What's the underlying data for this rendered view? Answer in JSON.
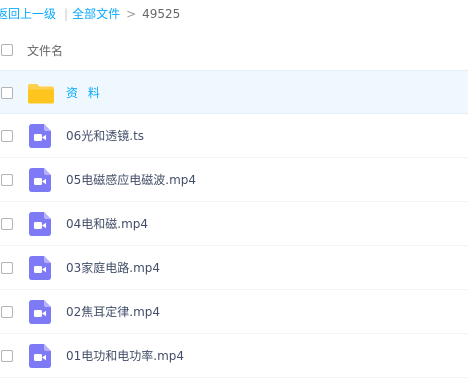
{
  "breadcrumb": {
    "back": "返回上一级",
    "sep_bar": "|",
    "all_files": "全部文件",
    "sep": ">",
    "current": "49525"
  },
  "header": {
    "column_name": "文件名"
  },
  "rows": [
    {
      "name": "资 料",
      "type": "folder"
    },
    {
      "name": "06光和透镜.ts",
      "type": "video"
    },
    {
      "name": "05电磁感应电磁波.mp4",
      "type": "video"
    },
    {
      "name": "04电和磁.mp4",
      "type": "video"
    },
    {
      "name": "03家庭电路.mp4",
      "type": "video"
    },
    {
      "name": "02焦耳定律.mp4",
      "type": "video"
    },
    {
      "name": "01电功和电功率.mp4",
      "type": "video"
    }
  ],
  "colors": {
    "accent": "#09aaff",
    "video_icon": "#7e79f4",
    "folder_icon": "#ffd04b"
  }
}
